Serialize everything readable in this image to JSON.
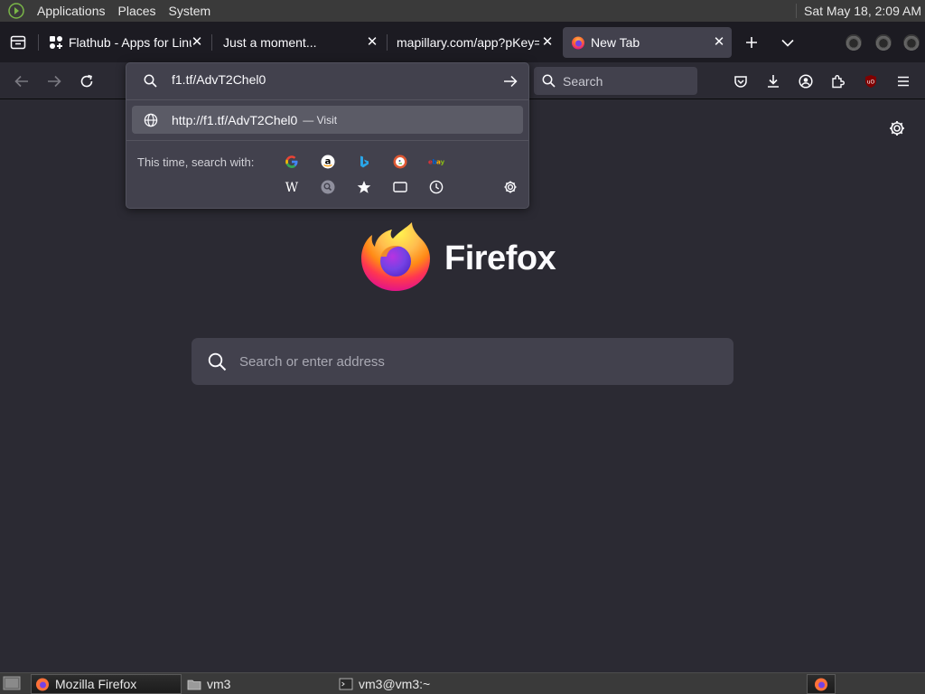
{
  "system_panel": {
    "menus": [
      "Applications",
      "Places",
      "System"
    ],
    "clock": "Sat May 18,  2:09 AM"
  },
  "tabs": [
    {
      "title": "Flathub - Apps for Linux",
      "active": false
    },
    {
      "title": "Just a moment...",
      "active": false
    },
    {
      "title": "mapillary.com/app?pKey=",
      "active": false
    },
    {
      "title": "New Tab",
      "active": true
    }
  ],
  "urlbar": {
    "value": "f1.tf/AdvT2Chel0",
    "result_url": "http://f1.tf/AdvT2Chel0",
    "result_action": "— Visit",
    "search_with_label": "This time, search with:",
    "engines": [
      "Google",
      "Amazon",
      "Bing",
      "DuckDuckGo",
      "eBay",
      "Wikipedia",
      "Search",
      "Bookmarks",
      "Tabs",
      "History"
    ]
  },
  "toolbar": {
    "search_placeholder": "Search"
  },
  "newtab": {
    "wordmark": "Firefox",
    "search_placeholder": "Search or enter address"
  },
  "taskbar": {
    "items": [
      "Mozilla Firefox",
      "vm3",
      "vm3@vm3:~"
    ]
  },
  "colors": {
    "accent": "#00ddff",
    "background": "#2b2a33",
    "tabstrip": "#1c1b22",
    "field": "#42414d"
  }
}
